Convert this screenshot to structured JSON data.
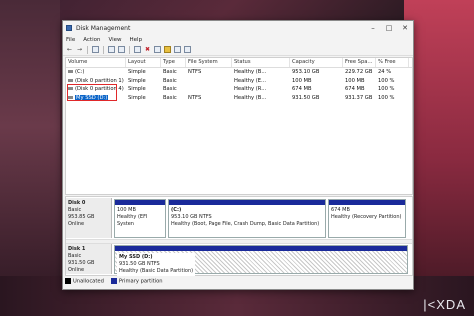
{
  "window": {
    "title": "Disk Management"
  },
  "menu": [
    "File",
    "Action",
    "View",
    "Help"
  ],
  "table": {
    "headers": [
      "Volume",
      "Layout",
      "Type",
      "File System",
      "Status",
      "Capacity",
      "Free Spa...",
      "% Free"
    ],
    "rows": [
      {
        "volume": "(C:)",
        "layout": "Simple",
        "type": "Basic",
        "fs": "NTFS",
        "status": "Healthy (B...",
        "capacity": "953.10 GB",
        "free": "229.72 GB",
        "pct": "24 %"
      },
      {
        "volume": "(Disk 0 partition 1)",
        "layout": "Simple",
        "type": "Basic",
        "fs": "",
        "status": "Healthy (E...",
        "capacity": "100 MB",
        "free": "100 MB",
        "pct": "100 %"
      },
      {
        "volume": "(Disk 0 partition 4)",
        "layout": "Simple",
        "type": "Basic",
        "fs": "",
        "status": "Healthy (R...",
        "capacity": "674 MB",
        "free": "674 MB",
        "pct": "100 %"
      },
      {
        "volume": "My SSD (D:)",
        "layout": "Simple",
        "type": "Basic",
        "fs": "NTFS",
        "status": "Healthy (B...",
        "capacity": "931.50 GB",
        "free": "931.37 GB",
        "pct": "100 %"
      }
    ]
  },
  "disks": [
    {
      "name": "Disk 0",
      "kind": "Basic",
      "size": "953.85 GB",
      "state": "Online",
      "partitions": [
        {
          "name": "",
          "line1": "100 MB",
          "line2": "Healthy (EFI Systen"
        },
        {
          "name": "(C:)",
          "line1": "953.10 GB NTFS",
          "line2": "Healthy (Boot, Page File, Crash Dump, Basic Data Partition)"
        },
        {
          "name": "",
          "line1": "674 MB",
          "line2": "Healthy (Recovery Partition)"
        }
      ]
    },
    {
      "name": "Disk 1",
      "kind": "Basic",
      "size": "931.50 GB",
      "state": "Online",
      "partitions": [
        {
          "name": "My SSD (D:)",
          "line1": "931.50 GB NTFS",
          "line2": "Healthy (Basic Data Partition)"
        }
      ]
    }
  ],
  "legend": [
    "Unallocated",
    "Primary partition"
  ],
  "watermark": "XDA",
  "colors": {
    "primary_partition": "#1a2a9a",
    "highlight": "#e0282a",
    "selection": "#0a64c8"
  }
}
